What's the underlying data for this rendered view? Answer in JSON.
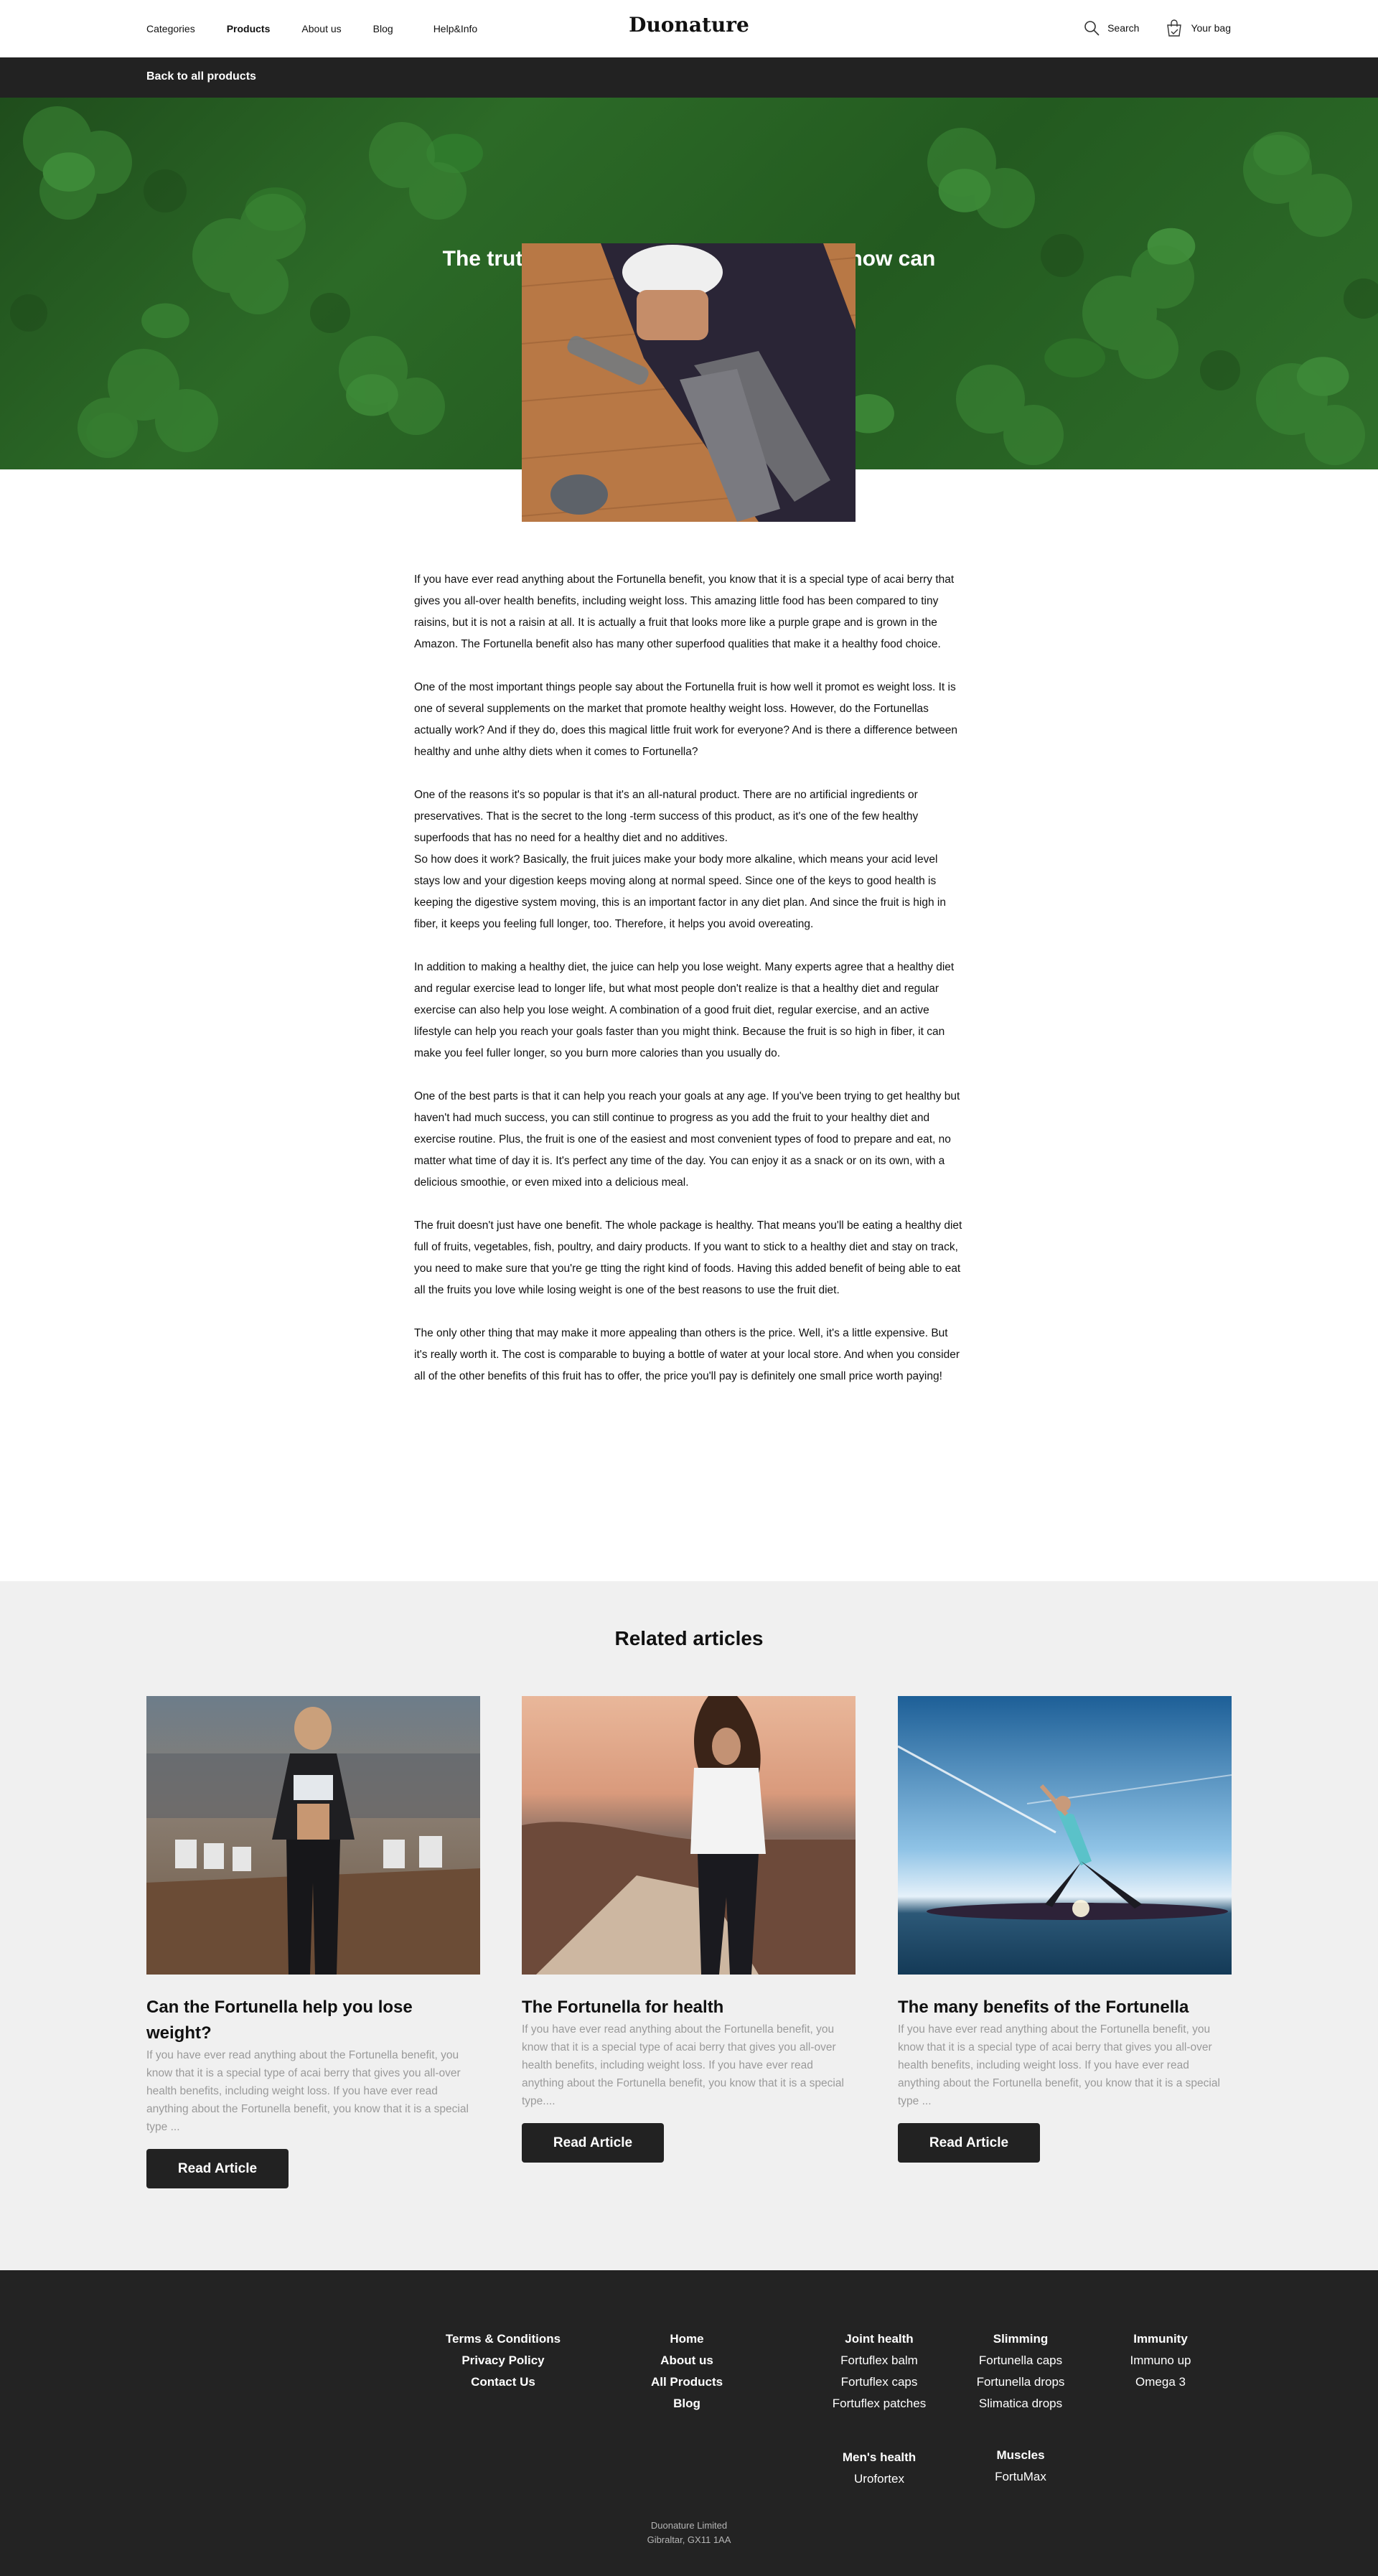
{
  "header": {
    "nav": [
      "Categories",
      "Products",
      "About us",
      "Blog",
      "Help&Info"
    ],
    "active_nav": "Products",
    "logo": "Duonature",
    "search_label": "Search",
    "bag_label": "Your bag"
  },
  "backbar": {
    "label": "Back to all products"
  },
  "hero": {
    "title": "The truth about the Fortunella benefit – how can it help you lose weight?"
  },
  "article": {
    "paragraphs": [
      "If you have ever read anything about the Fortunella benefit, you know that it is a special type of acai berry that gives you all-over health benefits, including weight loss. This amazing little food has been compared to tiny raisins, but it is not a raisin at all. It is actually a fruit that looks more like a purple grape and is grown in the Amazon. The Fortunella benefit also has many other superfood qualities that make it a healthy food choice.",
      "One of the most important things people say about the Fortunella fruit is how well it promot es weight loss. It is one of several supplements on the market that promote healthy weight loss. However, do the Fortunellas actually work? And if they do, does this magical little fruit work for everyone? And is there a difference between healthy and unhe althy diets when it comes to Fortunella?",
      "One of the reasons it's so popular is that it's an all-natural product. There are no artificial ingredients or preservatives. That is the secret to the long -term success of this product, as it's one of the few healthy superfoods that has no need for a healthy diet and no additives.\nSo how does it work? Basically, the fruit juices make your body more alkaline, which means your acid level stays low and your digestion keeps moving along at normal speed. Since one of the keys to good health is keeping the digestive system moving, this is an important factor in any diet plan. And since the fruit is high in fiber, it keeps you feeling full longer, too. Therefore, it helps you avoid overeating.",
      "In addition to making a healthy diet, the juice can help you lose weight. Many experts agree that a healthy diet and regular exercise lead to longer life, but what most people don't realize is that a healthy diet and regular exercise can also help you lose weight. A combination of a good fruit diet, regular exercise, and an active lifestyle can help you reach your goals faster than you might think. Because the fruit is so high in fiber, it can make you feel fuller longer, so you burn more calories than you usually do.",
      "One of the best parts is that it can help you reach your goals at any age. If you've been trying to get healthy but haven't had much success, you can still continue to progress as you add the fruit to your healthy diet and exercise routine. Plus, the fruit is one of the easiest and most convenient types of food to prepare and eat, no matter what time of day it is. It's perfect any time of the day. You can enjoy it as a snack or on its own, with a delicious smoothie, or even mixed into a delicious meal.",
      "The fruit doesn't just have one benefit. The whole package is healthy. That means you'll be eating a healthy diet full of fruits, vegetables, fish, poultry, and dairy products. If you want to stick to a healthy diet and stay on track, you need to make sure that you're ge tting the right kind of foods. Having this added benefit of being able to eat all the fruits you love while losing weight is one of the best reasons to use the fruit diet.",
      "The only other thing that may make it more appealing than others is the price. Well, it's a little expensive. But it's really worth it. The cost is comparable to buying a bottle of water at your local store. And when you consider all of the other benefits of this fruit has to offer, the price you'll pay is definitely one small price worth paying!"
    ]
  },
  "related": {
    "title": "Related articles",
    "cards": [
      {
        "title": "Can the Fortunella help you lose weight?",
        "text": "If you have ever read anything about the Fortunella benefit, you know that it is a special type of acai berry that gives you all-over health benefits, including weight loss. If you have ever read anything about the Fortunella benefit, you know that it is a special type ...",
        "button": "Read Article"
      },
      {
        "title": "The Fortunella for health",
        "text": "If you have ever read anything about the Fortunella benefit, you know that it is a special type of acai berry that gives you all-over health benefits, including weight loss. If you have ever read anything about the Fortunella benefit, you know that it is a special type....",
        "button": "Read Article"
      },
      {
        "title": "The many benefits of the Fortunella",
        "text": "If you have ever read anything about the Fortunella benefit, you know that it is a special type of acai berry that gives you all-over health benefits, including weight loss. If you have ever read anything about the Fortunella benefit, you know that it is a special type ...",
        "button": "Read Article"
      }
    ]
  },
  "footer": {
    "legal": [
      "Terms & Conditions",
      "Privacy Policy",
      "Contact Us"
    ],
    "site": [
      "Home",
      "About us",
      "All Products",
      "Blog"
    ],
    "categories": [
      {
        "heading": "Joint health",
        "items": [
          "Fortuflex balm",
          "Fortuflex caps",
          "Fortuflex patches"
        ]
      },
      {
        "heading": "Slimming",
        "items": [
          "Fortunella caps",
          "Fortunella drops",
          "Slimatica drops"
        ]
      },
      {
        "heading": "Immunity",
        "items": [
          "Immuno up",
          "Omega 3"
        ]
      },
      {
        "heading": "Men's health",
        "items": [
          "Urofortex"
        ]
      },
      {
        "heading": "Muscles",
        "items": [
          "FortuMax"
        ]
      }
    ],
    "company": "Duonature Limited",
    "address": "Gibraltar, GX11 1AA"
  }
}
